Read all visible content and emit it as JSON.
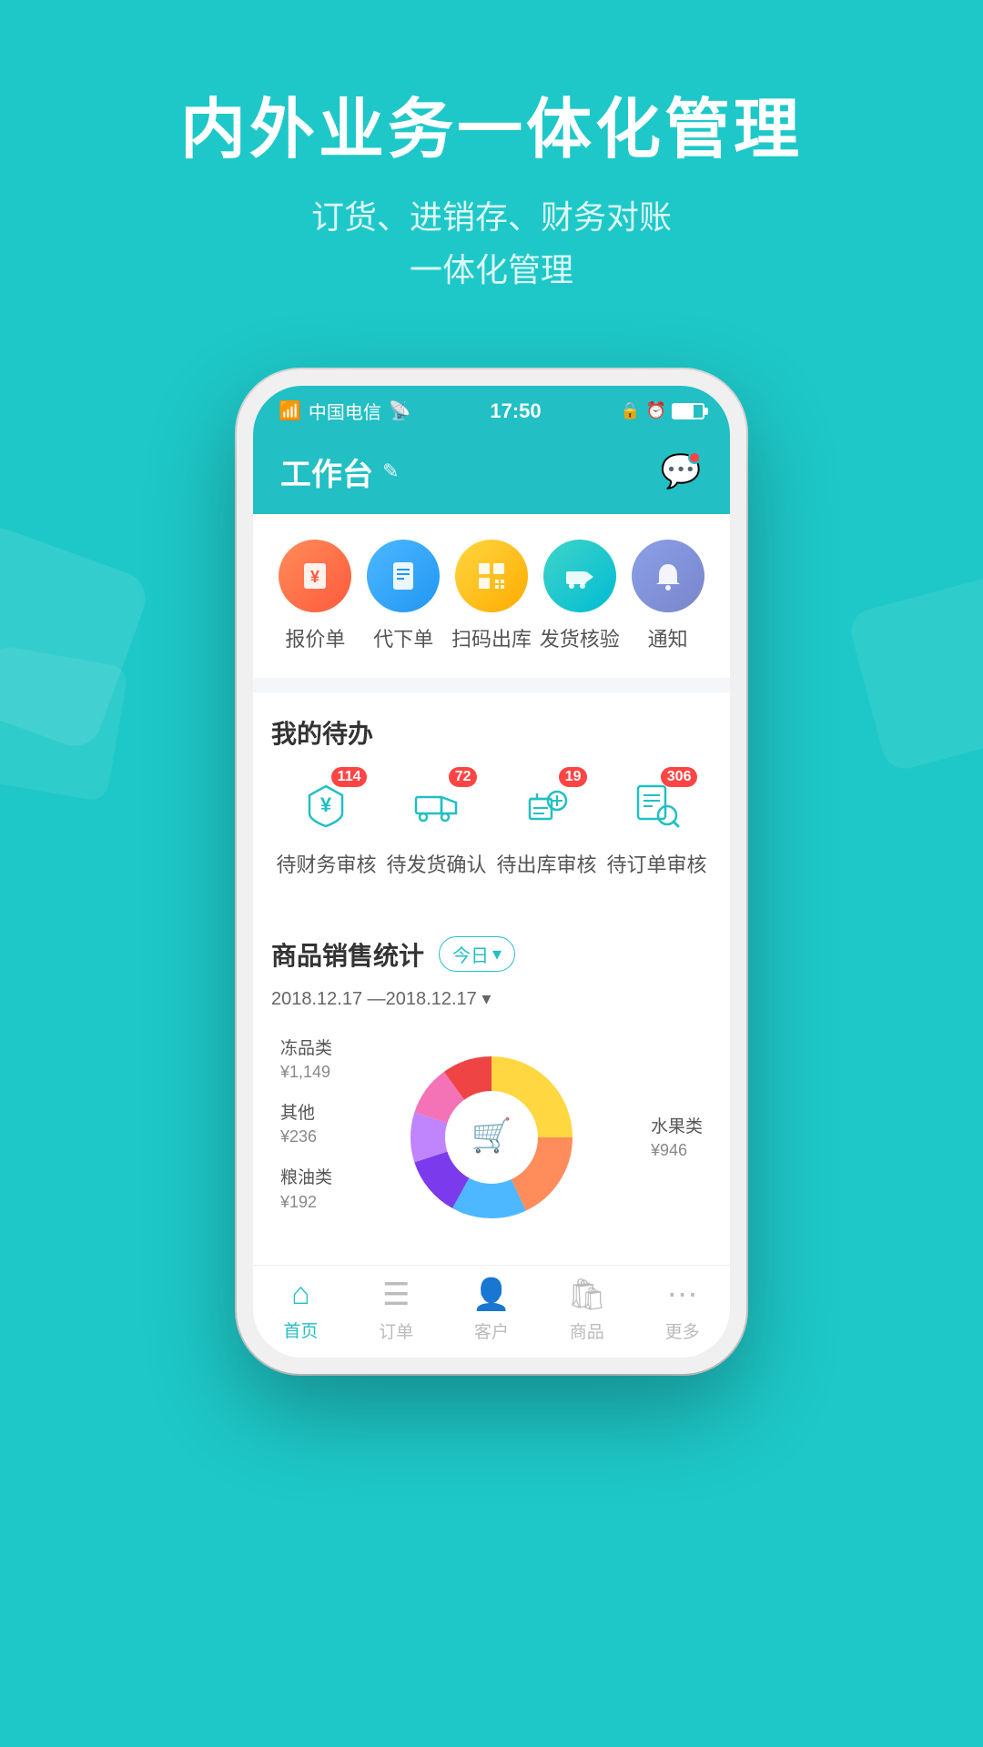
{
  "background_color": "#1ec8c8",
  "header": {
    "title": "内外业务一体化管理",
    "subtitle_line1": "订货、进销存、财务对账",
    "subtitle_line2": "一体化管理"
  },
  "status_bar": {
    "carrier": "中国电信",
    "time": "17:50"
  },
  "app_header": {
    "title": "工作台",
    "edit_icon": "✎",
    "chat_icon": "💬"
  },
  "quick_actions": [
    {
      "label": "报价单",
      "icon": "¥",
      "color_class": "icon-orange"
    },
    {
      "label": "代下单",
      "icon": "📋",
      "color_class": "icon-blue"
    },
    {
      "label": "扫码出库",
      "icon": "▦",
      "color_class": "icon-yellow"
    },
    {
      "label": "发货核验",
      "icon": "🚚",
      "color_class": "icon-teal"
    },
    {
      "label": "通知",
      "icon": "🔔",
      "color_class": "icon-purple"
    }
  ],
  "my_tasks": {
    "title": "我的待办",
    "items": [
      {
        "label": "待财务审核",
        "badge": "114",
        "icon": "shield"
      },
      {
        "label": "待发货确认",
        "badge": "72",
        "icon": "truck"
      },
      {
        "label": "待出库审核",
        "badge": "19",
        "icon": "cart"
      },
      {
        "label": "待订单审核",
        "badge": "306",
        "icon": "search"
      }
    ]
  },
  "sales_stats": {
    "title": "商品销售统计",
    "filter_label": "今日",
    "date_range": "2018.12.17 — 2018.12.17",
    "chart_labels_left": [
      {
        "name": "冻品类",
        "amount": "¥1,149"
      },
      {
        "name": "其他",
        "amount": "¥236"
      },
      {
        "name": "粮油类",
        "amount": "¥192"
      }
    ],
    "chart_labels_right": [
      {
        "name": "水果类",
        "amount": "¥946"
      }
    ],
    "donut_segments": [
      {
        "color": "#ffd740",
        "value": 25
      },
      {
        "color": "#ff8c5a",
        "value": 20
      },
      {
        "color": "#4db8ff",
        "value": 15
      },
      {
        "color": "#8b5cf6",
        "value": 12
      },
      {
        "color": "#c084fc",
        "value": 10
      },
      {
        "color": "#f472b6",
        "value": 8
      },
      {
        "color": "#ef4444",
        "value": 10
      }
    ]
  },
  "bottom_nav": [
    {
      "label": "首页",
      "active": true
    },
    {
      "label": "订单",
      "active": false
    },
    {
      "label": "客户",
      "active": false
    },
    {
      "label": "商品",
      "active": false
    },
    {
      "label": "更多",
      "active": false
    }
  ]
}
